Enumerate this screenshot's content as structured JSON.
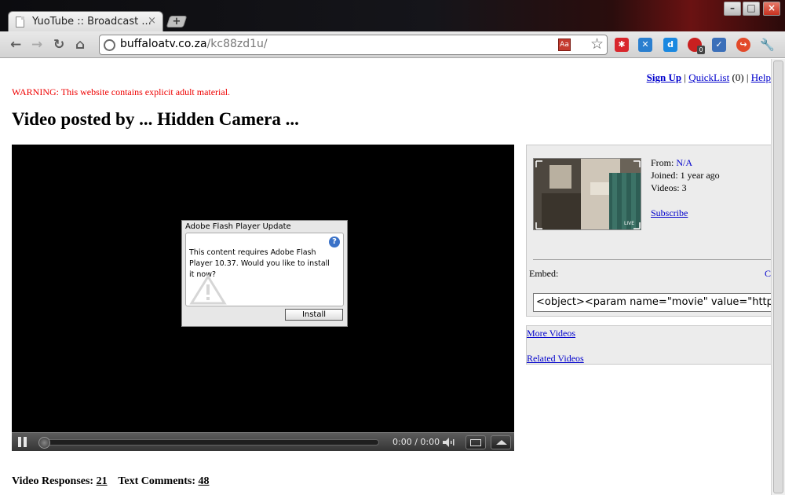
{
  "browser": {
    "tab_title": "YuoTube :: Broadcast ...",
    "tab_close": "×",
    "new_tab": "+",
    "url_domain": "buffaloatv.co.za",
    "url_path": "/kc88zd1u/",
    "ext_dict_label": "Aa",
    "ext_badge": "0"
  },
  "header": {
    "signup": "Sign Up",
    "separator1": " | ",
    "quicklist": "QuickList",
    "quicklist_count": " (0) | ",
    "help": "Help"
  },
  "warning": "WARNING: This website contains explicit adult material.",
  "title": "Video posted by ... Hidden Camera ...",
  "player": {
    "dialog_title": "Adobe Flash Player Update",
    "dialog_message": "This content requires Adobe Flash Player 10.37. Would you like to install it now?",
    "install_label": "Install",
    "time": "0:00 / 0:00"
  },
  "responses": {
    "video_label": "Video Responses:",
    "video_count": "21",
    "text_label": "Text Comments:",
    "text_count": "48"
  },
  "uploader": {
    "from_label": "From:",
    "from_value": "N/A",
    "joined": "Joined: 1 year ago",
    "videos": "Videos: 3",
    "subscribe": "Subscribe",
    "thumb_badge": "LIVE"
  },
  "embed": {
    "label": "Embed:",
    "side_link": "C",
    "code": "<object><param name=\"movie\" value=\"http://...\"><"
  },
  "links": {
    "more_videos": "More Videos",
    "related_videos": "Related Videos"
  }
}
